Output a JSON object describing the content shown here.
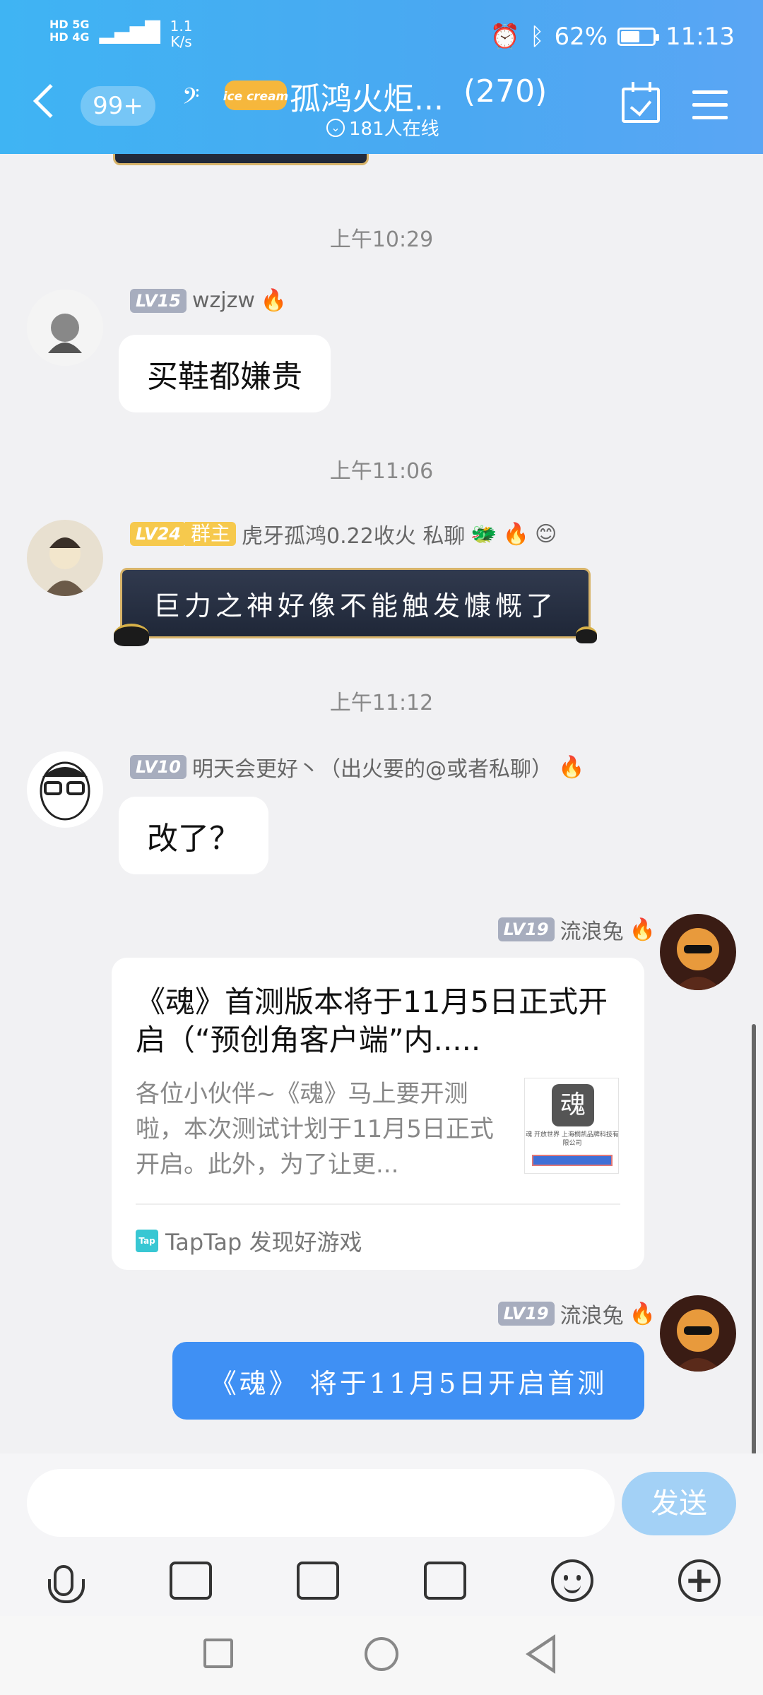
{
  "status_bar": {
    "signal_a": "HD 5G",
    "signal_b": "HD 4G",
    "net_speed": "1.1",
    "net_unit": "K/s",
    "battery": "62%",
    "battery_level": 0.62,
    "time": "11:13"
  },
  "header": {
    "unread": "99+",
    "title": "孤鸿火炬...",
    "member_count": "(270)",
    "online": "181人在线",
    "logo_text": "ice cream"
  },
  "messages": [
    {
      "time": "上午10:29",
      "level": "LV15",
      "name": "wzjzw",
      "text": "买鞋都嫌贵"
    },
    {
      "time": "上午11:06",
      "level": "LV24",
      "badge": "群主",
      "name": "虎牙孤鸿0.22收火 私聊",
      "text": "巨力之神好像不能触发慷慨了"
    },
    {
      "time": "上午11:12",
      "level": "LV10",
      "name": "明天会更好丶（出火要的@或者私聊）",
      "text": "改了？"
    },
    {
      "level": "LV19",
      "name": "流浪兔"
    },
    {
      "level": "LV19",
      "name": "流浪兔",
      "text": "《魂》 将于11月5日开启首测"
    }
  ],
  "share_card": {
    "title": "《魂》首测版本将于11月5日正式开启（“预创角客户端”内.....",
    "description": "各位小伙伴~《魂》马上要开测啦，本次测试计划于11月5日正式开启。此外，为了让更...",
    "source_icon": "Tap",
    "source": "TapTap 发现好游戏",
    "thumb_icon_text": "魂",
    "thumb_caption": "魂 开放世界 上海桐凯品牌科技有限公司"
  },
  "input": {
    "placeholder": "",
    "send": "发送"
  },
  "colors": {
    "header": "#4aa8f2",
    "send_button": "#a3d1f6",
    "self_bubble": "#3f90f4"
  }
}
